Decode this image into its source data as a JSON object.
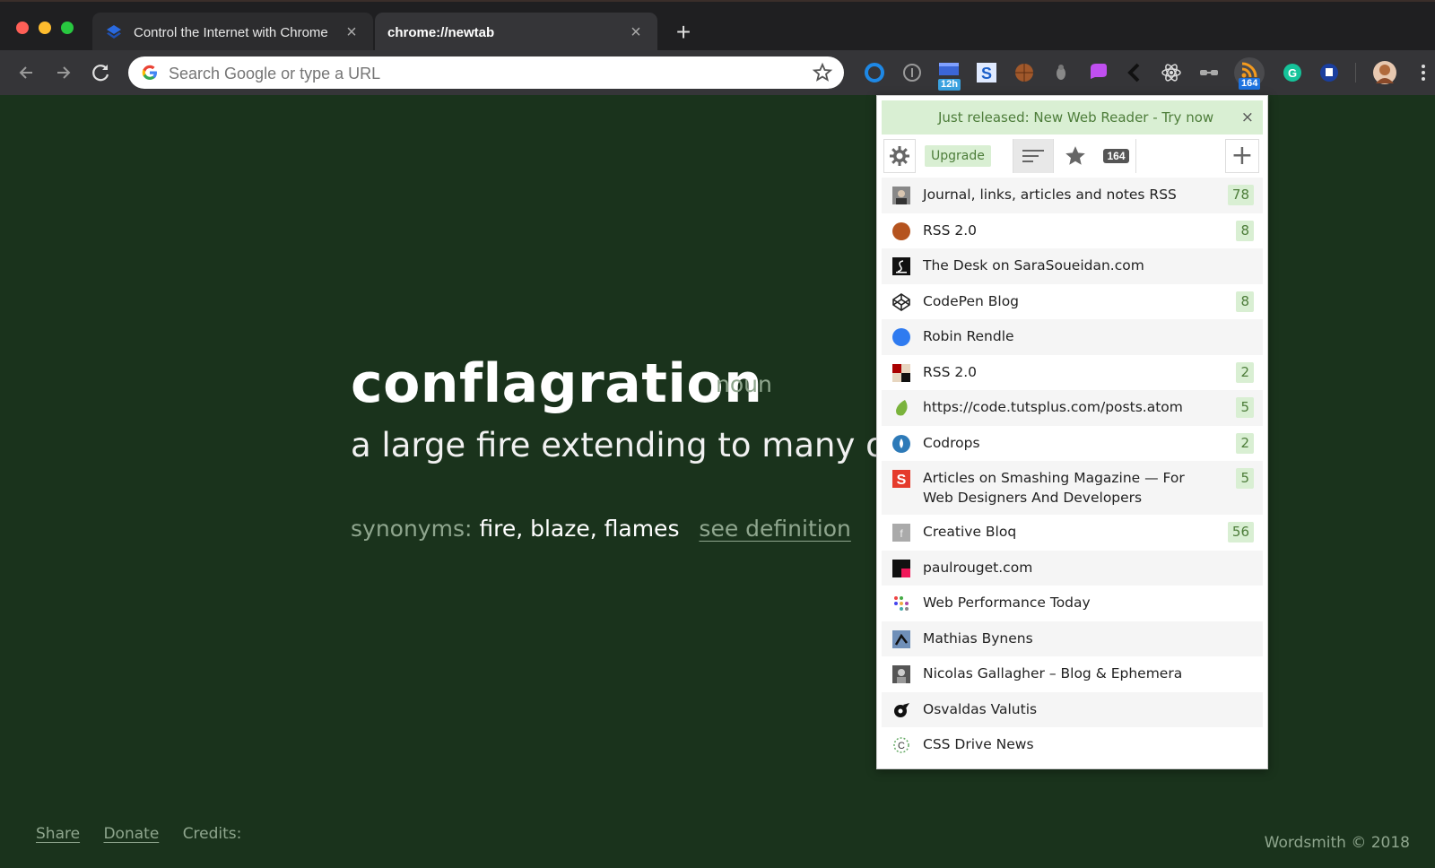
{
  "browser": {
    "tabs": [
      {
        "title": "Control the Internet with Chrome",
        "close": "×"
      },
      {
        "title": "chrome://newtab",
        "close": "×"
      }
    ],
    "new_tab_label": "+",
    "omnibox_placeholder": "Search Google or type a URL",
    "extension_badges": {
      "timer": "12h",
      "rss": "164"
    }
  },
  "page": {
    "word": "conflagration",
    "part_of_speech": "noun",
    "definition": "a large fire extending to many objects",
    "synonyms_label": "synonyms:",
    "synonyms": "fire, blaze, flames",
    "see_definition": "see definition",
    "footer": {
      "share": "Share",
      "donate": "Donate",
      "credits": "Credits:"
    },
    "copyright": "Wordsmith © 2018"
  },
  "popup": {
    "notice": "Just released: New Web Reader - Try now",
    "notice_close": "×",
    "upgrade": "Upgrade",
    "unread_total": "164",
    "add_label": "+",
    "feeds": [
      {
        "title": "Journal, links, articles and notes RSS",
        "count": "78",
        "icon": "avatar-photo-icon"
      },
      {
        "title": "RSS 2.0",
        "count": "8",
        "icon": "orange-circle-icon"
      },
      {
        "title": "The Desk on SaraSoueidan.com",
        "count": "",
        "icon": "sara-logo-icon"
      },
      {
        "title": "CodePen Blog",
        "count": "8",
        "icon": "codepen-icon"
      },
      {
        "title": "Robin Rendle",
        "count": "",
        "icon": "blue-circle-icon"
      },
      {
        "title": "RSS 2.0",
        "count": "2",
        "icon": "squares-icon"
      },
      {
        "title": "https://code.tutsplus.com/posts.atom",
        "count": "5",
        "icon": "envato-leaf-icon"
      },
      {
        "title": "Codrops",
        "count": "2",
        "icon": "codrops-drop-icon"
      },
      {
        "title": "Articles on Smashing Magazine — For Web Designers And Developers",
        "count": "5",
        "icon": "smashing-icon"
      },
      {
        "title": "Creative Bloq",
        "count": "56",
        "icon": "creative-bloq-icon"
      },
      {
        "title": "paulrouget.com",
        "count": "",
        "icon": "paulrouget-icon"
      },
      {
        "title": "Web Performance Today",
        "count": "",
        "icon": "dots-icon"
      },
      {
        "title": "Mathias Bynens",
        "count": "",
        "icon": "mathias-icon"
      },
      {
        "title": "Nicolas Gallagher – Blog & Ephemera",
        "count": "",
        "icon": "nicolas-photo-icon"
      },
      {
        "title": "Osvaldas Valutis",
        "count": "",
        "icon": "osvaldas-icon"
      },
      {
        "title": "CSS Drive News",
        "count": "",
        "icon": "css-drive-icon"
      }
    ]
  },
  "colors": {
    "page_bg": "#1a331c",
    "accent_green": "#4d7d3a",
    "badge_bg": "#d9efd3"
  }
}
